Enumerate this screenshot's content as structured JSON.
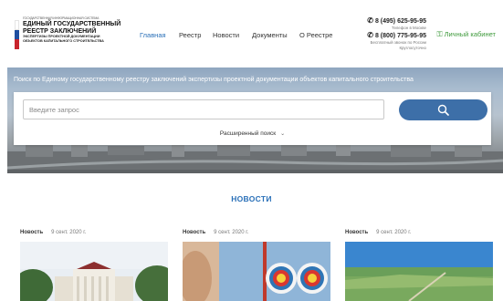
{
  "logo": {
    "top_line": "ГОСУДАРСТВЕННАЯ ИНФОРМАЦИОННАЯ СИСТЕМА",
    "line1": "ЕДИНЫЙ ГОСУДАРСТВЕННЫЙ",
    "line2": "РЕЕСТР ЗАКЛЮЧЕНИЙ",
    "sub1": "ЭКСПЕРТИЗЫ ПРОЕКТНОЙ ДОКУМЕНТАЦИИ",
    "sub2": "ОБЪЕКТОВ КАПИТАЛЬНОГО СТРОИТЕЛЬСТВА"
  },
  "nav": {
    "items": [
      {
        "label": "Главная",
        "active": true
      },
      {
        "label": "Реестр",
        "active": false
      },
      {
        "label": "Новости",
        "active": false
      },
      {
        "label": "Документы",
        "active": false
      },
      {
        "label": "О Реестре",
        "active": false
      }
    ]
  },
  "contacts": {
    "phone1": "8 (495) 625-95-95",
    "phone1_note": "Телефон в Москве",
    "phone2": "8 (800) 775-95-95",
    "phone2_note1": "Бесплатный звонок по России",
    "phone2_note2": "Круглосуточно",
    "icon": "phone-icon"
  },
  "cabinet": {
    "label": "Личный кабинет",
    "icon": "user-key-icon"
  },
  "hero": {
    "title": "Поиск по Единому государственному реестру заключений экспертизы проектной документации объектов капитального строительства"
  },
  "search": {
    "placeholder": "Введите запрос",
    "value": "",
    "button_icon": "search-icon",
    "advanced_label": "Расширенный поиск",
    "advanced_icon": "chevron-down-icon"
  },
  "news": {
    "title": "НОВОСТИ",
    "items": [
      {
        "category": "Новость",
        "date": "9 сент. 2020 г."
      },
      {
        "category": "Новость",
        "date": "9 сент. 2020 г."
      },
      {
        "category": "Новость",
        "date": "9 сент. 2020 г."
      }
    ]
  },
  "colors": {
    "accent": "#2a70b8",
    "button": "#3d6fa8",
    "cabinet": "#3f9a3c"
  }
}
